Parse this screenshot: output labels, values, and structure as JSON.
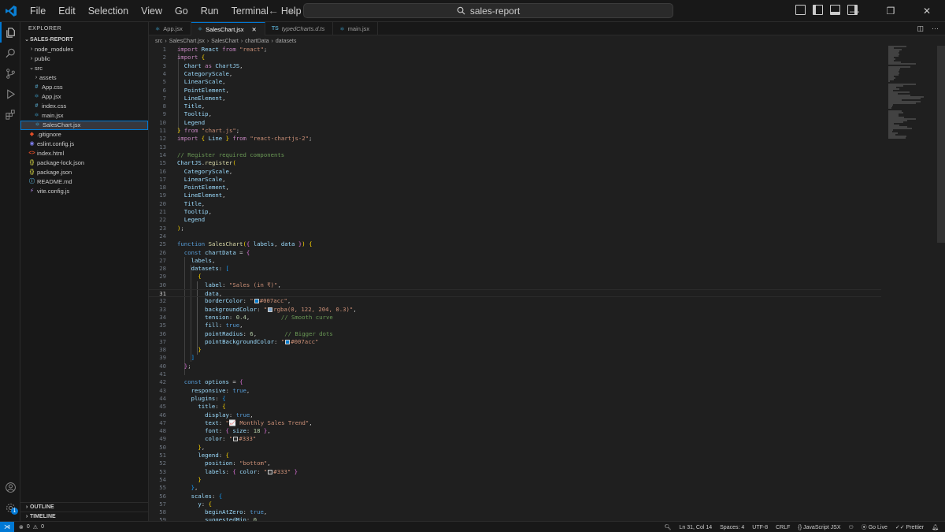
{
  "menu": [
    "File",
    "Edit",
    "Selection",
    "View",
    "Go",
    "Run",
    "Terminal",
    "Help"
  ],
  "search": {
    "text": "sales-report"
  },
  "explorer": {
    "title": "EXPLORER",
    "root": "SALES-REPORT",
    "items": [
      {
        "label": "node_modules",
        "indent": 1,
        "kind": "folder",
        "open": false
      },
      {
        "label": "public",
        "indent": 1,
        "kind": "folder",
        "open": false
      },
      {
        "label": "src",
        "indent": 1,
        "kind": "folder",
        "open": true
      },
      {
        "label": "assets",
        "indent": 2,
        "kind": "folder",
        "open": false
      },
      {
        "label": "App.css",
        "indent": 2,
        "kind": "css"
      },
      {
        "label": "App.jsx",
        "indent": 2,
        "kind": "jsx"
      },
      {
        "label": "index.css",
        "indent": 2,
        "kind": "css"
      },
      {
        "label": "main.jsx",
        "indent": 2,
        "kind": "jsx"
      },
      {
        "label": "SalesChart.jsx",
        "indent": 2,
        "kind": "jsx",
        "selected": true
      },
      {
        "label": ".gitignore",
        "indent": 1,
        "kind": "git"
      },
      {
        "label": "eslint.config.js",
        "indent": 1,
        "kind": "eslint"
      },
      {
        "label": "index.html",
        "indent": 1,
        "kind": "html"
      },
      {
        "label": "package-lock.json",
        "indent": 1,
        "kind": "json"
      },
      {
        "label": "package.json",
        "indent": 1,
        "kind": "json"
      },
      {
        "label": "README.md",
        "indent": 1,
        "kind": "md"
      },
      {
        "label": "vite.config.js",
        "indent": 1,
        "kind": "vite"
      }
    ],
    "outline": "OUTLINE",
    "timeline": "TIMELINE"
  },
  "tabs": [
    {
      "label": "App.jsx",
      "icon": "jsx",
      "active": false
    },
    {
      "label": "SalesChart.jsx",
      "icon": "jsx",
      "active": true
    },
    {
      "label": "typedCharts.d.ts",
      "icon": "ts",
      "active": false
    },
    {
      "label": "main.jsx",
      "icon": "jsx",
      "active": false
    }
  ],
  "breadcrumb": [
    "src",
    "SalesChart.jsx",
    "SalesChart",
    "chartData",
    "datasets"
  ],
  "colors": {
    "accent": "#0078d4",
    "swatch_blue": "#007acc",
    "swatch_grey": "#333333",
    "swatch_rgba": "#7aa3cc"
  },
  "code": [
    {
      "n": "1",
      "html": "<span class='kc'>import</span> <span class='v'>React</span> <span class='kc'>from</span> <span class='s'>\"react\"</span>;"
    },
    {
      "n": "2",
      "html": "<span class='kc'>import</span> <span class='b'>{</span>"
    },
    {
      "n": "3",
      "html": "  <span class='v'>Chart</span> <span class='kc'>as</span> <span class='v'>ChartJS</span>,"
    },
    {
      "n": "4",
      "html": "  <span class='v'>CategoryScale</span>,"
    },
    {
      "n": "5",
      "html": "  <span class='v'>LinearScale</span>,"
    },
    {
      "n": "6",
      "html": "  <span class='v'>PointElement</span>,"
    },
    {
      "n": "7",
      "html": "  <span class='v'>LineElement</span>,"
    },
    {
      "n": "8",
      "html": "  <span class='v'>Title</span>,"
    },
    {
      "n": "9",
      "html": "  <span class='v'>Tooltip</span>,"
    },
    {
      "n": "10",
      "html": "  <span class='v'>Legend</span>"
    },
    {
      "n": "11",
      "html": "<span class='b'>}</span> <span class='kc'>from</span> <span class='s'>\"chart.js\"</span>;"
    },
    {
      "n": "12",
      "html": "<span class='kc'>import</span> <span class='b'>{</span> <span class='v'>Line</span> <span class='b'>}</span> <span class='kc'>from</span> <span class='s'>\"react-chartjs-2\"</span>;"
    },
    {
      "n": "13",
      "html": ""
    },
    {
      "n": "14",
      "html": "<span class='c'>// Register required components</span>"
    },
    {
      "n": "15",
      "html": "<span class='v'>ChartJS</span>.<span class='f'>register</span><span class='b'>(</span>"
    },
    {
      "n": "16",
      "html": "  <span class='v'>CategoryScale</span>,"
    },
    {
      "n": "17",
      "html": "  <span class='v'>LinearScale</span>,"
    },
    {
      "n": "18",
      "html": "  <span class='v'>PointElement</span>,"
    },
    {
      "n": "19",
      "html": "  <span class='v'>LineElement</span>,"
    },
    {
      "n": "20",
      "html": "  <span class='v'>Title</span>,"
    },
    {
      "n": "21",
      "html": "  <span class='v'>Tooltip</span>,"
    },
    {
      "n": "22",
      "html": "  <span class='v'>Legend</span>"
    },
    {
      "n": "23",
      "html": "<span class='b'>)</span>;"
    },
    {
      "n": "24",
      "html": ""
    },
    {
      "n": "25",
      "html": "<span class='k'>function</span> <span class='f'>SalesChart</span><span class='b'>(</span><span class='b2'>{</span> <span class='v'>labels</span>, <span class='v'>data</span> <span class='b2'>}</span><span class='b'>)</span> <span class='b'>{</span>"
    },
    {
      "n": "26",
      "html": "  <span class='k'>const</span> <span class='v'>chartData</span> = <span class='b2'>{</span>"
    },
    {
      "n": "27",
      "html": "    <span class='v'>labels</span>,"
    },
    {
      "n": "28",
      "html": "    <span class='v'>datasets</span>: <span class='b3'>[</span>"
    },
    {
      "n": "29",
      "html": "      <span class='b'>{</span>"
    },
    {
      "n": "30",
      "html": "        <span class='v'>label</span>: <span class='s'>\"Sales (in ₹)\"</span>,"
    },
    {
      "n": "31",
      "html": "        <span class='v'>data</span>,",
      "current": true
    },
    {
      "n": "32",
      "html": "        <span class='v'>borderColor</span>: <span class='s'>\"<span class='sw' style='background:#007acc'></span>#007acc\"</span>,"
    },
    {
      "n": "33",
      "html": "        <span class='v'>backgroundColor</span>: <span class='s'>\"<span class='sw' style='background:#7aa3cc'></span>rgba(0, 122, 204, 0.3)\"</span>,"
    },
    {
      "n": "34",
      "html": "        <span class='v'>tension</span>: <span class='n'>0.4</span>,         <span class='c'>// Smooth curve</span>"
    },
    {
      "n": "35",
      "html": "        <span class='v'>fill</span>: <span class='k'>true</span>,"
    },
    {
      "n": "36",
      "html": "        <span class='v'>pointRadius</span>: <span class='n'>6</span>,        <span class='c'>// Bigger dots</span>"
    },
    {
      "n": "37",
      "html": "        <span class='v'>pointBackgroundColor</span>: <span class='s'>\"<span class='sw' style='background:#007acc'></span>#007acc\"</span>"
    },
    {
      "n": "38",
      "html": "      <span class='b'>}</span>"
    },
    {
      "n": "39",
      "html": "    <span class='b3'>]</span>"
    },
    {
      "n": "40",
      "html": "  <span class='b2'>}</span>;"
    },
    {
      "n": "41",
      "html": ""
    },
    {
      "n": "42",
      "html": "  <span class='k'>const</span> <span class='v'>options</span> = <span class='b2'>{</span>"
    },
    {
      "n": "43",
      "html": "    <span class='v'>responsive</span>: <span class='k'>true</span>,"
    },
    {
      "n": "44",
      "html": "    <span class='v'>plugins</span>: <span class='b3'>{</span>"
    },
    {
      "n": "45",
      "html": "      <span class='v'>title</span>: <span class='b'>{</span>"
    },
    {
      "n": "46",
      "html": "        <span class='v'>display</span>: <span class='k'>true</span>,"
    },
    {
      "n": "47",
      "html": "        <span class='v'>text</span>: <span class='s'>\"📈 Monthly Sales Trend\"</span>,"
    },
    {
      "n": "48",
      "html": "        <span class='v'>font</span>: <span class='b2'>{</span> <span class='v'>size</span>: <span class='n'>18</span> <span class='b2'>}</span>,"
    },
    {
      "n": "49",
      "html": "        <span class='v'>color</span>: <span class='s'>\"<span class='sw' style='background:#333333'></span>#333\"</span>"
    },
    {
      "n": "50",
      "html": "      <span class='b'>}</span>,"
    },
    {
      "n": "51",
      "html": "      <span class='v'>legend</span>: <span class='b'>{</span>"
    },
    {
      "n": "52",
      "html": "        <span class='v'>position</span>: <span class='s'>\"bottom\"</span>,"
    },
    {
      "n": "53",
      "html": "        <span class='v'>labels</span>: <span class='b2'>{</span> <span class='v'>color</span>: <span class='s'>\"<span class='sw' style='background:#333333'></span>#333\"</span> <span class='b2'>}</span>"
    },
    {
      "n": "54",
      "html": "      <span class='b'>}</span>"
    },
    {
      "n": "55",
      "html": "    <span class='b3'>}</span>,"
    },
    {
      "n": "56",
      "html": "    <span class='v'>scales</span>: <span class='b3'>{</span>"
    },
    {
      "n": "57",
      "html": "      <span class='v'>y</span>: <span class='b'>{</span>"
    },
    {
      "n": "58",
      "html": "        <span class='v'>beginAtZero</span>: <span class='k'>true</span>,"
    },
    {
      "n": "59",
      "html": "        <span class='v'>suggestedMin</span>: <span class='n'>0</span>,"
    }
  ],
  "status": {
    "errors": "0",
    "warnings": "0",
    "position": "Ln 31, Col 14",
    "spaces": "Spaces: 4",
    "encoding": "UTF-8",
    "eol": "CRLF",
    "language": "JavaScript JSX",
    "golive": "Go Live",
    "prettier": "Prettier"
  }
}
